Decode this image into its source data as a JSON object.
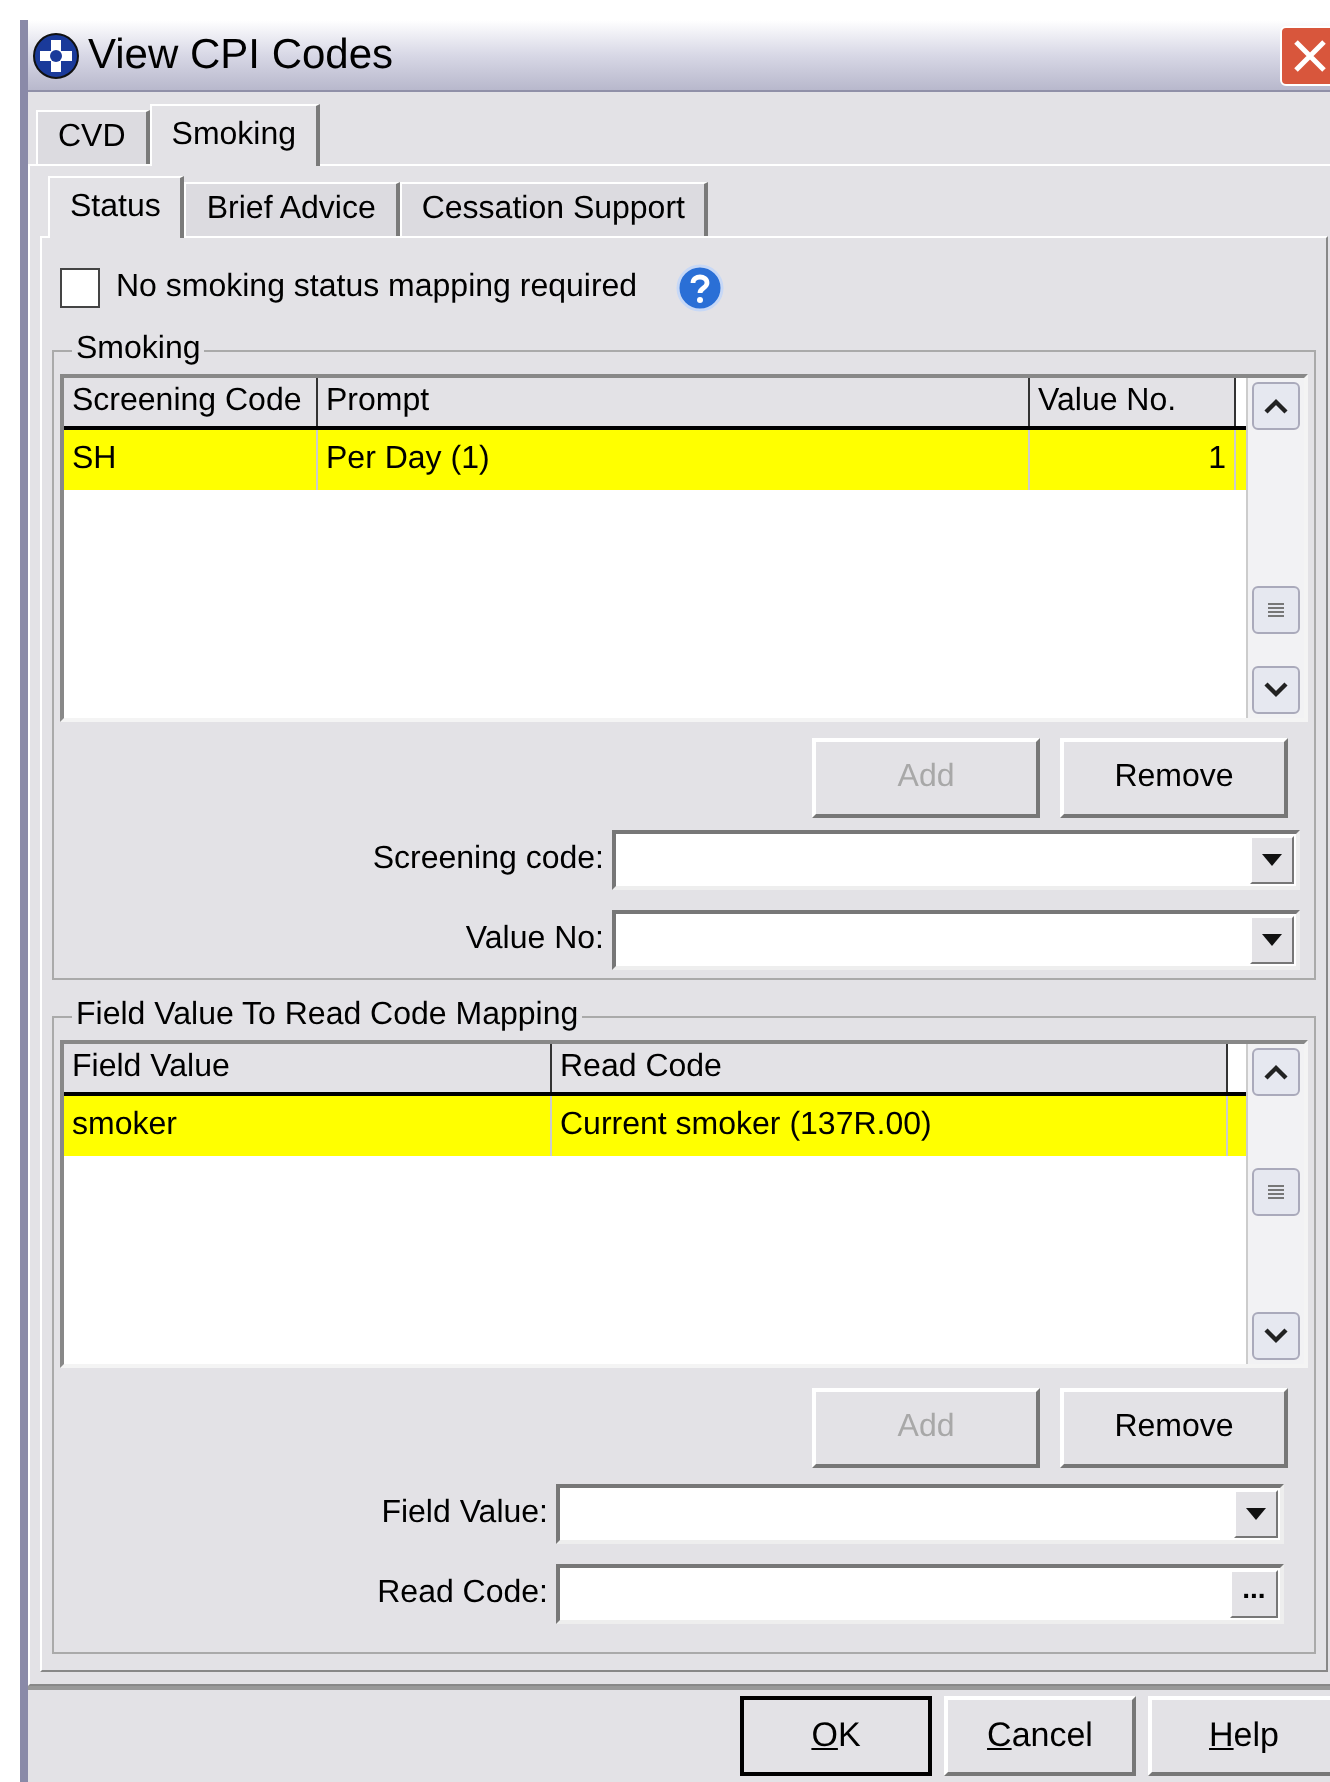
{
  "window": {
    "title": "View CPI Codes"
  },
  "tabs": [
    {
      "label": "CVD",
      "selected": false
    },
    {
      "label": "Smoking",
      "selected": true
    }
  ],
  "subtabs": [
    {
      "label": "Status",
      "selected": true
    },
    {
      "label": "Brief Advice",
      "selected": false
    },
    {
      "label": "Cessation Support",
      "selected": false
    }
  ],
  "no_mapping": {
    "label": "No smoking status mapping required",
    "checked": false
  },
  "smoking": {
    "title": "Smoking",
    "columns": [
      "Screening Code",
      "Prompt",
      "Value No."
    ],
    "rows": [
      {
        "cells": [
          "SH",
          "Per Day (1)",
          "1"
        ],
        "selected": true
      }
    ],
    "buttons": [
      {
        "label": "Add",
        "disabled": true
      },
      {
        "label": "Remove",
        "disabled": false
      }
    ],
    "fields": [
      {
        "label": "Screening code:",
        "kind": "dropdown"
      },
      {
        "label": "Value No:",
        "kind": "dropdown"
      }
    ]
  },
  "mapping": {
    "title": "Field Value To Read Code Mapping",
    "columns": [
      "Field Value",
      "Read Code"
    ],
    "rows": [
      {
        "cells": [
          "smoker",
          "Current smoker (137R.00)"
        ],
        "selected": true
      }
    ],
    "buttons": [
      {
        "label": "Add",
        "disabled": true
      },
      {
        "label": "Remove",
        "disabled": false
      }
    ],
    "fields": [
      {
        "label": "Field Value:",
        "kind": "dropdown"
      },
      {
        "label": "Read Code:",
        "kind": "browse",
        "browse_label": "..."
      }
    ]
  },
  "footer_buttons": [
    {
      "accelerator": "O",
      "rest": "K",
      "default": true
    },
    {
      "accelerator": "C",
      "rest": "ancel",
      "default": false
    },
    {
      "accelerator": "H",
      "rest": "elp",
      "default": false
    }
  ]
}
